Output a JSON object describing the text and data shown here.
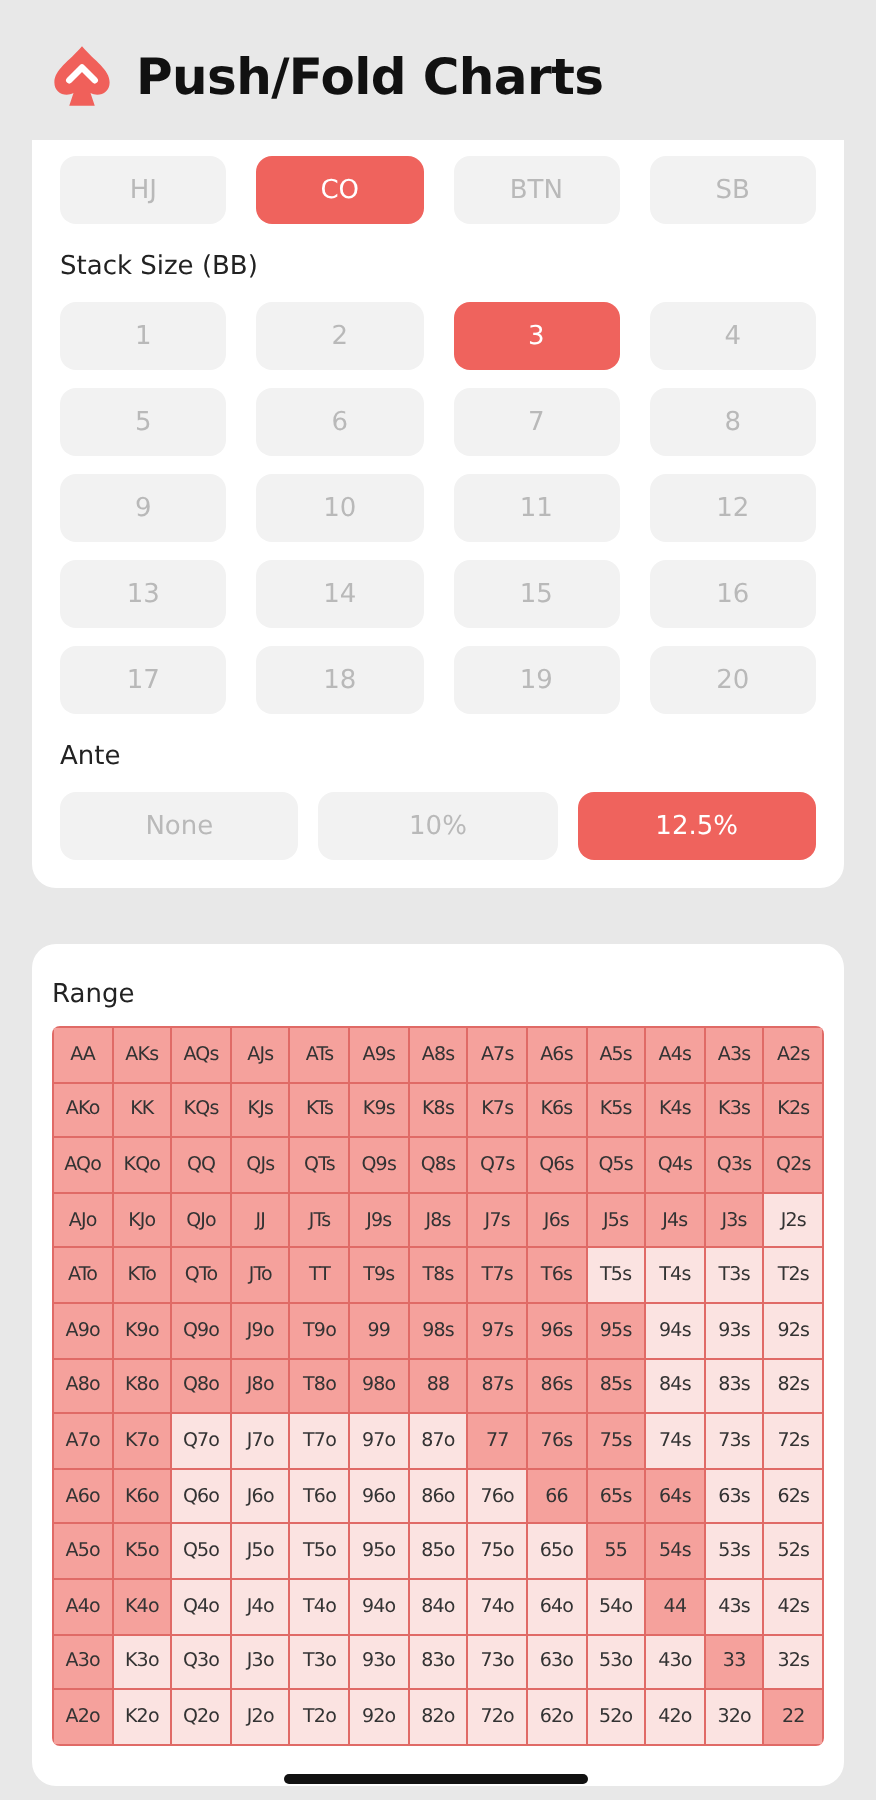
{
  "title": "Push/Fold Charts",
  "positions": [
    {
      "label": "HJ",
      "selected": false
    },
    {
      "label": "CO",
      "selected": true
    },
    {
      "label": "BTN",
      "selected": false
    },
    {
      "label": "SB",
      "selected": false
    }
  ],
  "stack_label": "Stack Size (BB)",
  "stacks": [
    {
      "label": "1",
      "selected": false
    },
    {
      "label": "2",
      "selected": false
    },
    {
      "label": "3",
      "selected": true
    },
    {
      "label": "4",
      "selected": false
    },
    {
      "label": "5",
      "selected": false
    },
    {
      "label": "6",
      "selected": false
    },
    {
      "label": "7",
      "selected": false
    },
    {
      "label": "8",
      "selected": false
    },
    {
      "label": "9",
      "selected": false
    },
    {
      "label": "10",
      "selected": false
    },
    {
      "label": "11",
      "selected": false
    },
    {
      "label": "12",
      "selected": false
    },
    {
      "label": "13",
      "selected": false
    },
    {
      "label": "14",
      "selected": false
    },
    {
      "label": "15",
      "selected": false
    },
    {
      "label": "16",
      "selected": false
    },
    {
      "label": "17",
      "selected": false
    },
    {
      "label": "18",
      "selected": false
    },
    {
      "label": "19",
      "selected": false
    },
    {
      "label": "20",
      "selected": false
    }
  ],
  "ante_label": "Ante",
  "antes": [
    {
      "label": "None",
      "selected": false
    },
    {
      "label": "10%",
      "selected": false
    },
    {
      "label": "12.5%",
      "selected": true
    }
  ],
  "range": {
    "title": "Range",
    "rows": [
      [
        {
          "label": "AA",
          "push": true
        },
        {
          "label": "AKs",
          "push": true
        },
        {
          "label": "AQs",
          "push": true
        },
        {
          "label": "AJs",
          "push": true
        },
        {
          "label": "ATs",
          "push": true
        },
        {
          "label": "A9s",
          "push": true
        },
        {
          "label": "A8s",
          "push": true
        },
        {
          "label": "A7s",
          "push": true
        },
        {
          "label": "A6s",
          "push": true
        },
        {
          "label": "A5s",
          "push": true
        },
        {
          "label": "A4s",
          "push": true
        },
        {
          "label": "A3s",
          "push": true
        },
        {
          "label": "A2s",
          "push": true
        }
      ],
      [
        {
          "label": "AKo",
          "push": true
        },
        {
          "label": "KK",
          "push": true
        },
        {
          "label": "KQs",
          "push": true
        },
        {
          "label": "KJs",
          "push": true
        },
        {
          "label": "KTs",
          "push": true
        },
        {
          "label": "K9s",
          "push": true
        },
        {
          "label": "K8s",
          "push": true
        },
        {
          "label": "K7s",
          "push": true
        },
        {
          "label": "K6s",
          "push": true
        },
        {
          "label": "K5s",
          "push": true
        },
        {
          "label": "K4s",
          "push": true
        },
        {
          "label": "K3s",
          "push": true
        },
        {
          "label": "K2s",
          "push": true
        }
      ],
      [
        {
          "label": "AQo",
          "push": true
        },
        {
          "label": "KQo",
          "push": true
        },
        {
          "label": "QQ",
          "push": true
        },
        {
          "label": "QJs",
          "push": true
        },
        {
          "label": "QTs",
          "push": true
        },
        {
          "label": "Q9s",
          "push": true
        },
        {
          "label": "Q8s",
          "push": true
        },
        {
          "label": "Q7s",
          "push": true
        },
        {
          "label": "Q6s",
          "push": true
        },
        {
          "label": "Q5s",
          "push": true
        },
        {
          "label": "Q4s",
          "push": true
        },
        {
          "label": "Q3s",
          "push": true
        },
        {
          "label": "Q2s",
          "push": true
        }
      ],
      [
        {
          "label": "AJo",
          "push": true
        },
        {
          "label": "KJo",
          "push": true
        },
        {
          "label": "QJo",
          "push": true
        },
        {
          "label": "JJ",
          "push": true
        },
        {
          "label": "JTs",
          "push": true
        },
        {
          "label": "J9s",
          "push": true
        },
        {
          "label": "J8s",
          "push": true
        },
        {
          "label": "J7s",
          "push": true
        },
        {
          "label": "J6s",
          "push": true
        },
        {
          "label": "J5s",
          "push": true
        },
        {
          "label": "J4s",
          "push": true
        },
        {
          "label": "J3s",
          "push": true
        },
        {
          "label": "J2s",
          "push": false
        }
      ],
      [
        {
          "label": "ATo",
          "push": true
        },
        {
          "label": "KTo",
          "push": true
        },
        {
          "label": "QTo",
          "push": true
        },
        {
          "label": "JTo",
          "push": true
        },
        {
          "label": "TT",
          "push": true
        },
        {
          "label": "T9s",
          "push": true
        },
        {
          "label": "T8s",
          "push": true
        },
        {
          "label": "T7s",
          "push": true
        },
        {
          "label": "T6s",
          "push": true
        },
        {
          "label": "T5s",
          "push": false
        },
        {
          "label": "T4s",
          "push": false
        },
        {
          "label": "T3s",
          "push": false
        },
        {
          "label": "T2s",
          "push": false
        }
      ],
      [
        {
          "label": "A9o",
          "push": true
        },
        {
          "label": "K9o",
          "push": true
        },
        {
          "label": "Q9o",
          "push": true
        },
        {
          "label": "J9o",
          "push": true
        },
        {
          "label": "T9o",
          "push": true
        },
        {
          "label": "99",
          "push": true
        },
        {
          "label": "98s",
          "push": true
        },
        {
          "label": "97s",
          "push": true
        },
        {
          "label": "96s",
          "push": true
        },
        {
          "label": "95s",
          "push": true
        },
        {
          "label": "94s",
          "push": false
        },
        {
          "label": "93s",
          "push": false
        },
        {
          "label": "92s",
          "push": false
        }
      ],
      [
        {
          "label": "A8o",
          "push": true
        },
        {
          "label": "K8o",
          "push": true
        },
        {
          "label": "Q8o",
          "push": true
        },
        {
          "label": "J8o",
          "push": true
        },
        {
          "label": "T8o",
          "push": true
        },
        {
          "label": "98o",
          "push": true
        },
        {
          "label": "88",
          "push": true
        },
        {
          "label": "87s",
          "push": true
        },
        {
          "label": "86s",
          "push": true
        },
        {
          "label": "85s",
          "push": true
        },
        {
          "label": "84s",
          "push": false
        },
        {
          "label": "83s",
          "push": false
        },
        {
          "label": "82s",
          "push": false
        }
      ],
      [
        {
          "label": "A7o",
          "push": true
        },
        {
          "label": "K7o",
          "push": true
        },
        {
          "label": "Q7o",
          "push": false
        },
        {
          "label": "J7o",
          "push": false
        },
        {
          "label": "T7o",
          "push": false
        },
        {
          "label": "97o",
          "push": false
        },
        {
          "label": "87o",
          "push": false
        },
        {
          "label": "77",
          "push": true
        },
        {
          "label": "76s",
          "push": true
        },
        {
          "label": "75s",
          "push": true
        },
        {
          "label": "74s",
          "push": false
        },
        {
          "label": "73s",
          "push": false
        },
        {
          "label": "72s",
          "push": false
        }
      ],
      [
        {
          "label": "A6o",
          "push": true
        },
        {
          "label": "K6o",
          "push": true
        },
        {
          "label": "Q6o",
          "push": false
        },
        {
          "label": "J6o",
          "push": false
        },
        {
          "label": "T6o",
          "push": false
        },
        {
          "label": "96o",
          "push": false
        },
        {
          "label": "86o",
          "push": false
        },
        {
          "label": "76o",
          "push": false
        },
        {
          "label": "66",
          "push": true
        },
        {
          "label": "65s",
          "push": true
        },
        {
          "label": "64s",
          "push": true
        },
        {
          "label": "63s",
          "push": false
        },
        {
          "label": "62s",
          "push": false
        }
      ],
      [
        {
          "label": "A5o",
          "push": true
        },
        {
          "label": "K5o",
          "push": true
        },
        {
          "label": "Q5o",
          "push": false
        },
        {
          "label": "J5o",
          "push": false
        },
        {
          "label": "T5o",
          "push": false
        },
        {
          "label": "95o",
          "push": false
        },
        {
          "label": "85o",
          "push": false
        },
        {
          "label": "75o",
          "push": false
        },
        {
          "label": "65o",
          "push": false
        },
        {
          "label": "55",
          "push": true
        },
        {
          "label": "54s",
          "push": true
        },
        {
          "label": "53s",
          "push": false
        },
        {
          "label": "52s",
          "push": false
        }
      ],
      [
        {
          "label": "A4o",
          "push": true
        },
        {
          "label": "K4o",
          "push": true
        },
        {
          "label": "Q4o",
          "push": false
        },
        {
          "label": "J4o",
          "push": false
        },
        {
          "label": "T4o",
          "push": false
        },
        {
          "label": "94o",
          "push": false
        },
        {
          "label": "84o",
          "push": false
        },
        {
          "label": "74o",
          "push": false
        },
        {
          "label": "64o",
          "push": false
        },
        {
          "label": "54o",
          "push": false
        },
        {
          "label": "44",
          "push": true
        },
        {
          "label": "43s",
          "push": false
        },
        {
          "label": "42s",
          "push": false
        }
      ],
      [
        {
          "label": "A3o",
          "push": true
        },
        {
          "label": "K3o",
          "push": false
        },
        {
          "label": "Q3o",
          "push": false
        },
        {
          "label": "J3o",
          "push": false
        },
        {
          "label": "T3o",
          "push": false
        },
        {
          "label": "93o",
          "push": false
        },
        {
          "label": "83o",
          "push": false
        },
        {
          "label": "73o",
          "push": false
        },
        {
          "label": "63o",
          "push": false
        },
        {
          "label": "53o",
          "push": false
        },
        {
          "label": "43o",
          "push": false
        },
        {
          "label": "33",
          "push": true
        },
        {
          "label": "32s",
          "push": false
        }
      ],
      [
        {
          "label": "A2o",
          "push": true
        },
        {
          "label": "K2o",
          "push": false
        },
        {
          "label": "Q2o",
          "push": false
        },
        {
          "label": "J2o",
          "push": false
        },
        {
          "label": "T2o",
          "push": false
        },
        {
          "label": "92o",
          "push": false
        },
        {
          "label": "82o",
          "push": false
        },
        {
          "label": "72o",
          "push": false
        },
        {
          "label": "62o",
          "push": false
        },
        {
          "label": "52o",
          "push": false
        },
        {
          "label": "42o",
          "push": false
        },
        {
          "label": "32o",
          "push": false
        },
        {
          "label": "22",
          "push": true
        }
      ]
    ]
  }
}
